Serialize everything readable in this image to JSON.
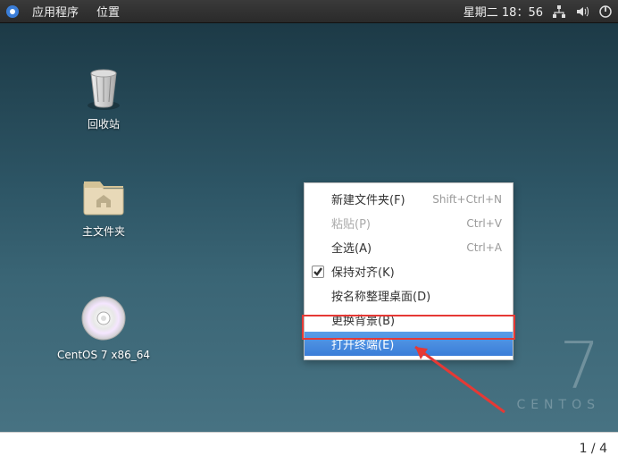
{
  "topbar": {
    "applications": "应用程序",
    "places": "位置",
    "clock": "星期二 18：56"
  },
  "desktop_icons": {
    "trash": "回收站",
    "home": "主文件夹",
    "disc": "CentOS 7 x86_64"
  },
  "brand": {
    "number": "7",
    "name": "CENTOS"
  },
  "menu": {
    "new_folder": {
      "label": "新建文件夹(F)",
      "shortcut": "Shift+Ctrl+N"
    },
    "paste": {
      "label": "粘贴(P)",
      "shortcut": "Ctrl+V"
    },
    "select_all": {
      "label": "全选(A)",
      "shortcut": "Ctrl+A"
    },
    "keep_aligned": {
      "label": "保持对齐(K)"
    },
    "organize_by_name": {
      "label": "按名称整理桌面(D)"
    },
    "change_background": {
      "label": "更换背景(B)"
    },
    "open_terminal": {
      "label": "打开终端(E)"
    }
  },
  "footer": {
    "workspace": "1  /  4"
  }
}
